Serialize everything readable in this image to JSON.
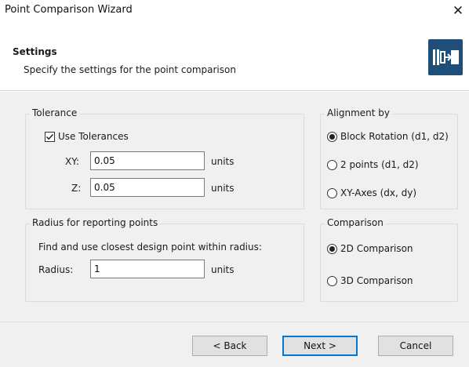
{
  "window": {
    "title": "Point Comparison Wizard",
    "close_glyph": "✕"
  },
  "header": {
    "title": "Settings",
    "subtitle": "Specify the settings for the point comparison",
    "icon": "wizard-logo-icon",
    "accent_color": "#1f4e79"
  },
  "tolerance": {
    "title": "Tolerance",
    "use_tolerances_label": "Use Tolerances",
    "use_tolerances_checked": true,
    "xy_label": "XY:",
    "xy_value": "0.05",
    "xy_unit": "units",
    "z_label": "Z:",
    "z_value": "0.05",
    "z_unit": "units"
  },
  "radius": {
    "title": "Radius for reporting points",
    "description": "Find and use closest design point within radius:",
    "radius_label": "Radius:",
    "radius_value": "1",
    "radius_unit": "units"
  },
  "alignment": {
    "title": "Alignment by",
    "options": [
      {
        "label": "Block Rotation (d1, d2)",
        "selected": true
      },
      {
        "label": "2 points (d1, d2)",
        "selected": false
      },
      {
        "label": "XY-Axes (dx, dy)",
        "selected": false
      }
    ]
  },
  "comparison": {
    "title": "Comparison",
    "options": [
      {
        "label": "2D Comparison",
        "selected": true
      },
      {
        "label": "3D Comparison",
        "selected": false
      }
    ]
  },
  "buttons": {
    "back": "< Back",
    "next": "Next >",
    "cancel": "Cancel"
  }
}
